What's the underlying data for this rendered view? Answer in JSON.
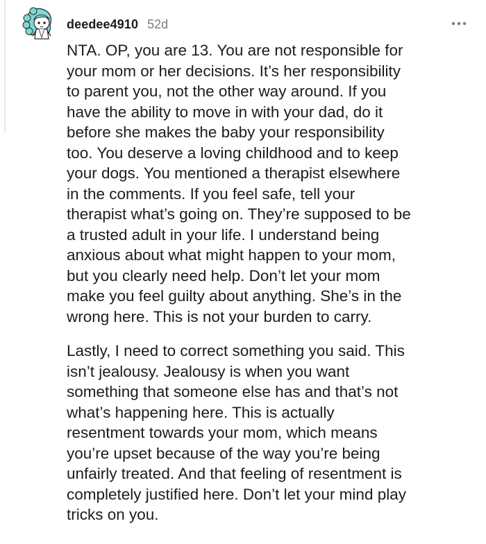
{
  "comment": {
    "author": "deedee4910",
    "age": "52d",
    "avatar_icon": "snoo-avatar-icon",
    "more_icon": "more-options-icon",
    "paragraphs": [
      "NTA. OP, you are 13. You are not responsible for\nyour mom or her decisions. It’s her responsibility\nto parent you, not the other way around. If you\nhave the ability to move in with your dad, do it\nbefore she makes the baby your responsibility\ntoo. You deserve a loving childhood and to keep\nyour dogs. You mentioned a therapist elsewhere\nin the comments. If you feel safe, tell your\ntherapist what’s going on. They’re supposed to be\na trusted adult in your life. I understand being\nanxious about what might happen to your mom,\nbut you clearly need help. Don’t let your mom\nmake you feel guilty about anything. She’s in the\nwrong here. This is not your burden to carry.",
      "Lastly, I need to correct something you said. This\nisn’t jealousy. Jealousy is when you want\nsomething that someone else has and that’s not\nwhat’s happening here. This is actually\nresentment towards your mom, which means\nyou’re upset because of the way you’re being\nunfairly treated. And that feeling of resentment is\ncompletely justified here. Don’t let your mind play\ntricks on you."
    ]
  },
  "colors": {
    "text": "#1c1c1c",
    "meta": "#7c7c7c",
    "avatar_hair": "#7fd8d6",
    "thread_line": "#e8e8e8"
  }
}
